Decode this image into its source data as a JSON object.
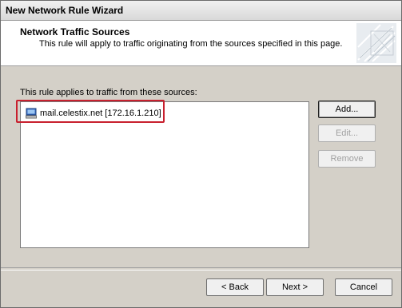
{
  "window": {
    "title": "New Network Rule Wizard"
  },
  "header": {
    "title": "Network Traffic Sources",
    "subtitle": "This rule will apply to traffic originating from the sources specified in this page."
  },
  "sources": {
    "label": "This rule applies to traffic from these sources:",
    "items": [
      {
        "icon": "computer-icon",
        "text": "mail.celestix.net [172.16.1.210]"
      }
    ]
  },
  "side_buttons": {
    "add": "Add...",
    "edit": "Edit...",
    "remove": "Remove"
  },
  "nav_buttons": {
    "back": "< Back",
    "next": "Next >",
    "cancel": "Cancel"
  },
  "colors": {
    "highlight_box": "#c8202e",
    "dialog_face": "#d4d0c8"
  }
}
